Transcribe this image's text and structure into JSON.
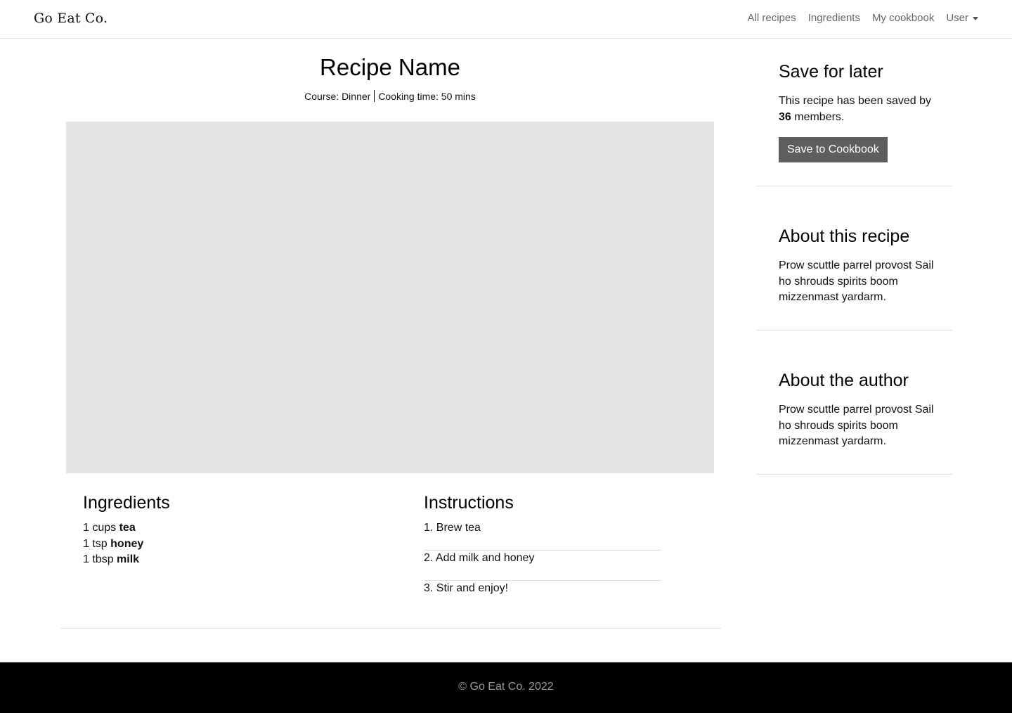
{
  "header": {
    "brand": "Go Eat Co.",
    "nav": [
      {
        "label": "All recipes"
      },
      {
        "label": "Ingredients"
      },
      {
        "label": "My cookbook"
      }
    ],
    "user_label": "User"
  },
  "recipe": {
    "title": "Recipe Name",
    "course": "Course: Dinner",
    "cooking_time": "Cooking time: 50 mins"
  },
  "ingredients": {
    "heading": "Ingredients",
    "items": [
      {
        "qty": "1 cups",
        "name": "tea"
      },
      {
        "qty": "1 tsp",
        "name": "honey"
      },
      {
        "qty": "1 tbsp",
        "name": "milk"
      }
    ]
  },
  "instructions": {
    "heading": "Instructions",
    "steps": [
      {
        "text": "1. Brew tea"
      },
      {
        "text": "2. Add milk and honey"
      },
      {
        "text": "3. Stir and enjoy!"
      }
    ]
  },
  "sidebar": {
    "save": {
      "heading": "Save for later",
      "text_before": "This recipe has been saved by",
      "count": "36",
      "text_after": "members.",
      "button_label": "Save to Cookbook"
    },
    "about_recipe": {
      "heading": "About this recipe",
      "body": "Prow scuttle parrel provost Sail ho shrouds spirits boom mizzenmast yardarm."
    },
    "about_author": {
      "heading": "About the author",
      "body": "Prow scuttle parrel provost Sail ho shrouds spirits boom mizzenmast yardarm."
    }
  },
  "footer": {
    "text": "© Go Eat Co. 2022"
  },
  "colors": {
    "image_placeholder": "#e4e4e4",
    "button_bg": "#5e5e5e",
    "footer_bg": "#000000",
    "nav_link": "#666666"
  }
}
